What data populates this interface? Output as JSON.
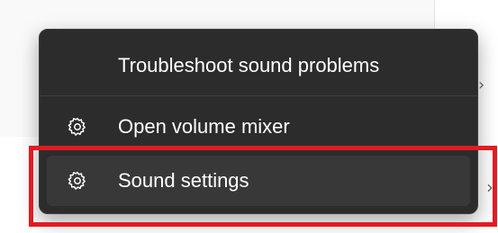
{
  "menu": {
    "items": [
      {
        "label": "Troubleshoot sound problems",
        "icon": ""
      },
      {
        "label": "Open volume mixer",
        "icon": "gear-icon"
      },
      {
        "label": "Sound settings",
        "icon": "gear-icon",
        "state": "hovered"
      }
    ]
  },
  "background": {
    "chevrons": [
      "›",
      "›"
    ]
  },
  "annotation": {
    "color": "#e21b23",
    "target": "sound-settings-item"
  },
  "colors": {
    "menu_background": "#2c2c2c",
    "menu_hover": "#383838",
    "text": "#ffffff"
  }
}
